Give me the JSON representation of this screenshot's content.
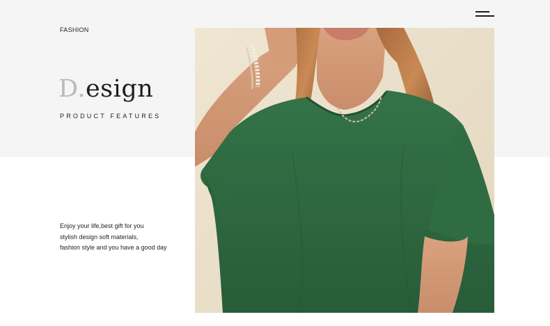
{
  "header": {
    "category": "FASHION",
    "menu_icon": "hamburger-menu-icon"
  },
  "hero": {
    "title_initial": "D.",
    "title_rest": "esign",
    "subtitle": "PRODUCT FEATURES"
  },
  "description": {
    "lines": [
      "Enjoy your life,best gift for you",
      "stylish design soft materials,",
      "fashion style and you have a good day"
    ]
  },
  "colors": {
    "top_band": "#f5f5f5",
    "shirt": "#2e6b3f",
    "background_wall": "#e9dfcb"
  }
}
